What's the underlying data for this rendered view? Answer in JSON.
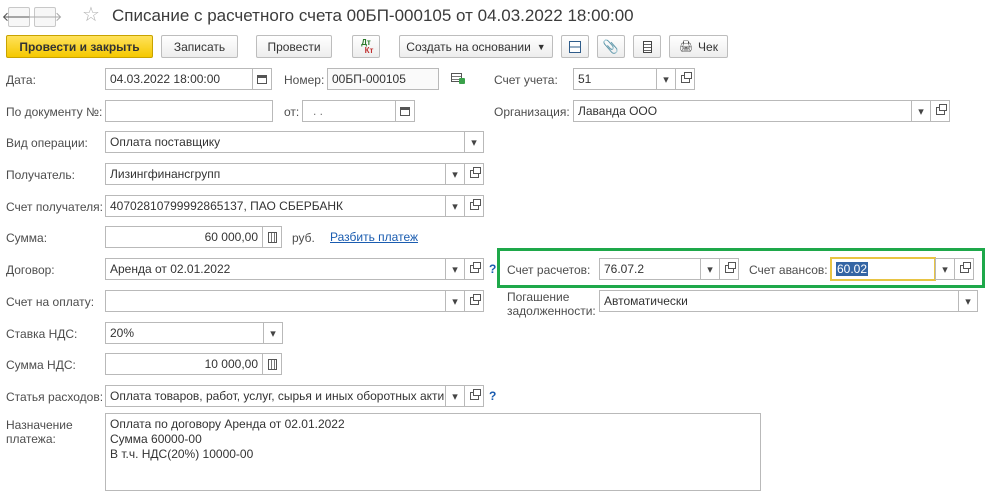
{
  "window": {
    "title": "Списание с расчетного счета 00БП-000105 от 04.03.2022 18:00:00"
  },
  "toolbar": {
    "post_and_close": "Провести и закрыть",
    "save": "Записать",
    "post": "Провести",
    "dtkt_top": "Дт",
    "dtkt_bottom": "Кт",
    "create_based_on": "Создать на основании",
    "receipt": "Чек"
  },
  "form": {
    "date_label": "Дата:",
    "date_value": "04.03.2022 18:00:00",
    "number_label": "Номер:",
    "number_value": "00БП-000105",
    "account_label": "Счет учета:",
    "account_value": "51",
    "by_document_label": "По документу №:",
    "by_document_value": "",
    "from_label": "от:",
    "from_value": " .  .",
    "organization_label": "Организация:",
    "organization_value": "Лаванда ООО",
    "operation_label": "Вид операции:",
    "operation_value": "Оплата поставщику",
    "recipient_label": "Получатель:",
    "recipient_value": "Лизингфинансгрупп",
    "recipient_account_label": "Счет получателя:",
    "recipient_account_value": "40702810799992865137, ПАО СБЕРБАНК",
    "amount_label": "Сумма:",
    "amount_value": "60 000,00",
    "currency": "руб.",
    "split_payment": "Разбить платеж",
    "contract_label": "Договор:",
    "contract_value": "Аренда от 02.01.2022",
    "settlement_account_label": "Счет расчетов:",
    "settlement_account_value": "76.07.2",
    "advance_account_label": "Счет авансов:",
    "advance_account_value": "60.02",
    "invoice_label": "Счет на оплату:",
    "invoice_value": "",
    "debt_repayment_label_1": "Погашение",
    "debt_repayment_label_2": "задолженности:",
    "debt_repayment_value": "Автоматически",
    "vat_rate_label": "Ставка НДС:",
    "vat_rate_value": "20%",
    "vat_amount_label": "Сумма НДС:",
    "vat_amount_value": "10 000,00",
    "expense_item_label": "Статья расходов:",
    "expense_item_value": "Оплата товаров, работ, услуг, сырья и иных оборотных акти",
    "purpose_label_1": "Назначение",
    "purpose_label_2": "платежа:",
    "purpose_value": "Оплата по договору Аренда от 02.01.2022\nСумма 60000-00\nВ т.ч. НДС(20%) 10000-00",
    "help": "?"
  },
  "colors": {
    "primary_button": "#f5c800",
    "highlight_box": "#1ea84a",
    "focused_field": "#e8c443",
    "link": "#1a5cb0"
  }
}
